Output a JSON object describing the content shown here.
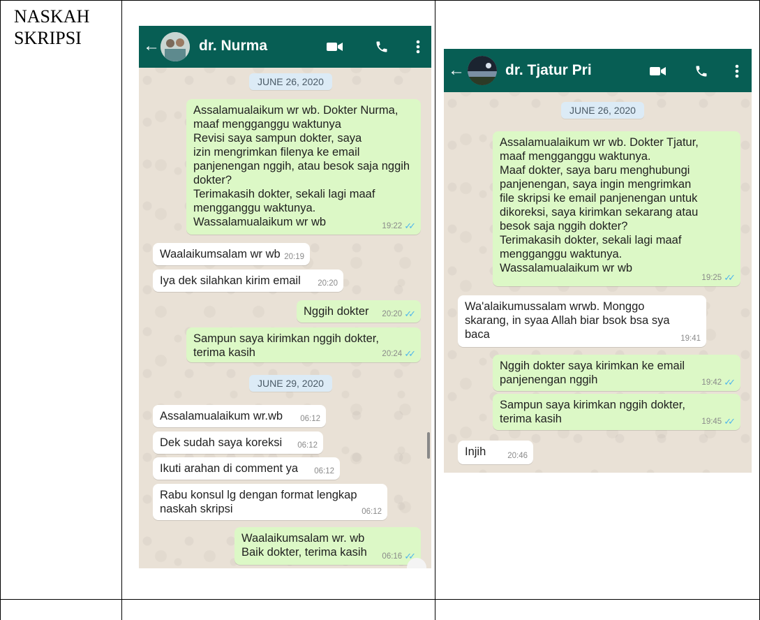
{
  "document": {
    "label": "NASKAH\nSKRIPSI"
  },
  "left_chat": {
    "contact_name": "dr. Nurma",
    "back_icon": "back-arrow-icon",
    "video_icon": "video-call-icon",
    "call_icon": "phone-call-icon",
    "menu_icon": "more-vert-icon",
    "date1": "JUNE 26, 2020",
    "date2": "JUNE 29, 2020",
    "messages": [
      {
        "dir": "out",
        "text": "Assalamualaikum wr wb. Dokter Nurma,\nmaaf mengganggu waktunya\nRevisi saya sampun dokter, saya\nizin mengrimkan filenya ke email\npanjenengan nggih, atau besok saja nggih\ndokter?\nTerimakasih dokter, sekali lagi maaf\nmengganggu waktunya.\nWassalamualaikum wr wb",
        "time": "19:22"
      },
      {
        "dir": "in",
        "text": "Waalaikumsalam wr wb",
        "time": "20:19"
      },
      {
        "dir": "in",
        "text": "Iya dek silahkan kirim email",
        "time": "20:20"
      },
      {
        "dir": "out",
        "text": "Nggih dokter",
        "time": "20:20"
      },
      {
        "dir": "out",
        "text": "Sampun saya kirimkan nggih dokter,\nterima kasih",
        "time": "20:24"
      },
      {
        "dir": "in",
        "text": "Assalamualaikum wr.wb",
        "time": "06:12"
      },
      {
        "dir": "in",
        "text": "Dek sudah saya koreksi",
        "time": "06:12"
      },
      {
        "dir": "in",
        "text": "Ikuti arahan di comment ya",
        "time": "06:12"
      },
      {
        "dir": "in",
        "text": "Rabu konsul lg dengan format lengkap\nnaskah skripsi",
        "time": "06:12"
      },
      {
        "dir": "out",
        "text": "Waalaikumsalam wr. wb\nBaik dokter, terima kasih",
        "time": "06:16"
      }
    ]
  },
  "right_chat": {
    "contact_name": "dr. Tjatur Pri",
    "date1": "JUNE 26, 2020",
    "messages": [
      {
        "dir": "out",
        "text": "Assalamualaikum wr wb. Dokter Tjatur,\nmaaf mengganggu waktunya.\nMaaf dokter, saya baru menghubungi\npanjenengan, saya ingin mengrimkan\nfile skripsi ke email panjenengan untuk\ndikoreksi, saya kirimkan sekarang atau\nbesok saja nggih dokter?\nTerimakasih dokter, sekali lagi maaf\nmengganggu waktunya.\nWassalamualaikum wr wb",
        "time": "19:25"
      },
      {
        "dir": "in",
        "text": "Wa'alaikumussalam wrwb. Monggo\nskarang, in syaa Allah biar bsok bsa sya\nbaca",
        "time": "19:41"
      },
      {
        "dir": "out",
        "text": "Nggih dokter saya kirimkan ke email\npanjenengan nggih",
        "time": "19:42"
      },
      {
        "dir": "out",
        "text": "Sampun saya kirimkan nggih dokter,\nterima kasih",
        "time": "19:45"
      },
      {
        "dir": "in",
        "text": "Injih",
        "time": "20:46"
      }
    ]
  },
  "colors": {
    "appbar": "#075e54",
    "outgoing_bubble": "#dcf8c6",
    "incoming_bubble": "#ffffff",
    "read_tick": "#4fb6ec",
    "date_chip": "#dcebf6"
  }
}
